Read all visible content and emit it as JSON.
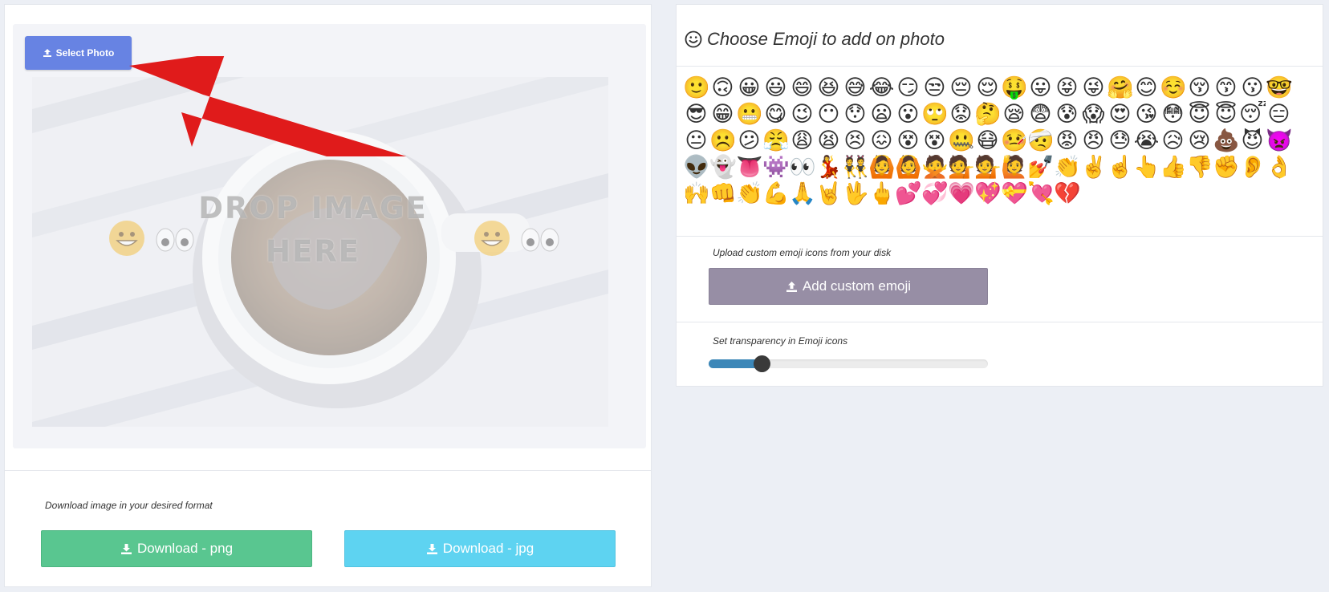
{
  "left": {
    "select_photo_label": "Select Photo",
    "drop_text_line1": "DROP IMAGE",
    "drop_text_line2": "HERE",
    "download_caption": "Download image in your desired format",
    "download_png_label": "Download - png",
    "download_jpg_label": "Download - jpg",
    "colors": {
      "select_button": "#6783e3",
      "download_png": "#59c690",
      "download_jpg": "#5ed3f1",
      "arrow": "#e01b1b"
    }
  },
  "right": {
    "title": "Choose Emoji to add on photo",
    "emojis": [
      "🙂",
      "🙃",
      "😀",
      "😃",
      "😄",
      "😆",
      "😅",
      "😂",
      "😏",
      "😒",
      "😔",
      "😌",
      "🤑",
      "😛",
      "😝",
      "😜",
      "🤗",
      "😊",
      "☺️",
      "😚",
      "😙",
      "😗",
      "🤓",
      "😎",
      "😁",
      "😬",
      "😋",
      "😉",
      "😶",
      "😯",
      "😦",
      "😮",
      "🙄",
      "😟",
      "🤔",
      "😪",
      "😨",
      "😰",
      "😱",
      "😍",
      "😘",
      "😳",
      "😇",
      "😇",
      "😴",
      "😑",
      "😐",
      "☹️",
      "😕",
      "😤",
      "😩",
      "😫",
      "😣",
      "😖",
      "😵",
      "😵",
      "🤐",
      "😷",
      "🤒",
      "🤕",
      "😡",
      "😠",
      "😓",
      "😭",
      "😥",
      "😢",
      "💩",
      "😈",
      "👿",
      "👽",
      "👻",
      "👅",
      "👾",
      "👀",
      "💃",
      "👯",
      "🙆",
      "🙆",
      "🙅",
      "💁",
      "💁",
      "🙋",
      "💅",
      "👏",
      "✌️",
      "☝️",
      "👆",
      "👍",
      "👎",
      "✊",
      "👂",
      "👌",
      "🙌",
      "👊",
      "👏",
      "💪",
      "🙏",
      "🤘",
      "🖖",
      "🖕",
      "💕",
      "💞",
      "💗",
      "💖",
      "💝",
      "💘",
      "💔"
    ],
    "custom_caption": "Upload custom emoji icons from your disk",
    "custom_button_label": "Add custom emoji",
    "transparency_caption": "Set transparency in Emoji icons",
    "transparency_value": 0.19,
    "colors": {
      "custom_button": "#978ea5",
      "slider_fill": "#3c87b8",
      "slider_thumb": "#3a3a3a"
    }
  }
}
